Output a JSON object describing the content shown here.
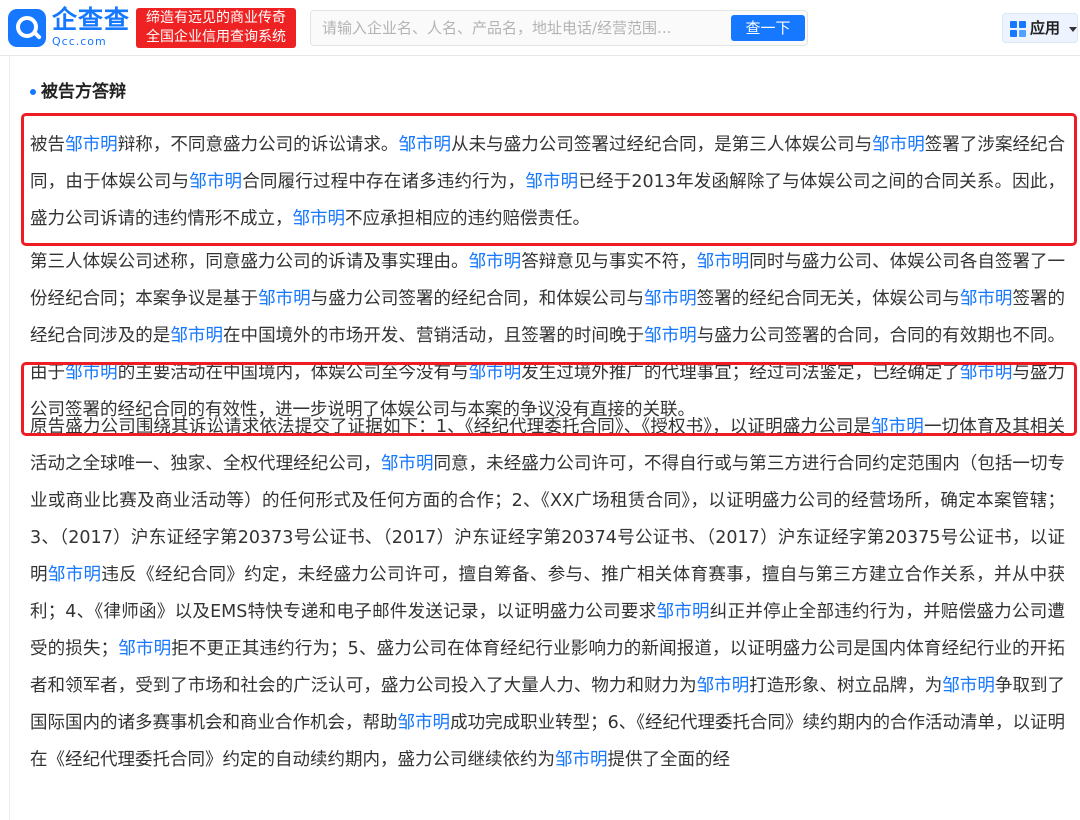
{
  "header": {
    "logo_cn": "企查查",
    "logo_en": "Qcc.com",
    "slogan_line1": "缔造有远见的商业传奇",
    "slogan_line2": "全国企业信用查询系统",
    "search_placeholder": "请输入企业名、人名、产品名，地址电话/经营范围...",
    "search_button": "查一下",
    "apps_label": "应用"
  },
  "colors": {
    "brand": "#1677ff",
    "highlight_border": "#ee1c24",
    "slogan_bg": "#ee2222",
    "link": "#1677ff"
  },
  "icons": [
    "qcc-logo-icon",
    "apps-grid-icon",
    "chevron-down-icon"
  ],
  "section": {
    "title": "被告方答辩"
  },
  "article": {
    "p1": [
      {
        "t": "被告"
      },
      {
        "t": "邹市明",
        "link": true
      },
      {
        "t": "辩称，不同意盛力公司的诉讼请求。"
      },
      {
        "t": "邹市明",
        "link": true
      },
      {
        "t": "从未与盛力公司签署过经纪合同，是第三人体娱公司与"
      },
      {
        "t": "邹市明",
        "link": true
      },
      {
        "t": "签署了涉案经纪合同，由于体娱公司与"
      },
      {
        "t": "邹市明",
        "link": true
      },
      {
        "t": "合同履行过程中存在诸多违约行为，"
      },
      {
        "t": "邹市明",
        "link": true
      },
      {
        "t": "已经于2013年发函解除了与体娱公司之间的合同关系。因此，盛力公司诉请的违约情形不成立，"
      },
      {
        "t": "邹市明",
        "link": true
      },
      {
        "t": "不应承担相应的违约赔偿责任。"
      }
    ],
    "p2": [
      {
        "t": "第三人体娱公司述称，同意盛力公司的诉请及事实理由。"
      },
      {
        "t": "邹市明",
        "link": true
      },
      {
        "t": "答辩意见与事实不符，"
      },
      {
        "t": "邹市明",
        "link": true
      },
      {
        "t": "同时与盛力公司、体娱公司各自签署了一份经纪合同；本案争议是基于"
      },
      {
        "t": "邹市明",
        "link": true
      },
      {
        "t": "与盛力公司签署的经纪合同，和体娱公司与"
      },
      {
        "t": "邹市明",
        "link": true
      },
      {
        "t": "签署的经纪合同无关，体娱公司与"
      },
      {
        "t": "邹市明",
        "link": true
      },
      {
        "t": "签署的经纪合同涉及的是"
      },
      {
        "t": "邹市明",
        "link": true
      },
      {
        "t": "在中国境外的市场开发、营销活动，且签署的时间晚于"
      },
      {
        "t": "邹市明",
        "link": true
      },
      {
        "t": "与盛力公司签署的合同，合同的有效期也不同。由于"
      },
      {
        "t": "邹市明",
        "link": true
      },
      {
        "t": "的主要活动在中国境内，体娱公司至今没有与"
      },
      {
        "t": "邹市明",
        "link": true
      },
      {
        "t": "发生过境外推广的代理事宜；经过司法鉴定，已经确定了"
      },
      {
        "t": "邹市明",
        "link": true
      },
      {
        "t": "与盛力公司签署的经纪合同的有效性，进一步说明了体娱公司与本案的争议没有直接的关联。"
      }
    ],
    "p3": [
      {
        "t": "原告盛力公司围绕其诉讼请求依法提交了证据如下：1、《经纪代理委托合同》、《授权书》，以证明盛力公司是"
      },
      {
        "t": "邹市明",
        "link": true
      },
      {
        "t": "一切体育及其相关活动之全球唯一、独家、全权代理经纪公司，"
      },
      {
        "t": "邹市明",
        "link": true
      },
      {
        "t": "同意，未经盛力公司许可，不得自行或与第三方进行合同约定范围内（包括一切专业或商业比赛及商业活动等）的任何形式及任何方面的合作；2、《XX广场租赁合同》，以证明盛力公司的经营场所，确定本案管辖；3、（2017）沪东证经字第20373号公证书、（2017）沪东证经字第20374号公证书、（2017）沪东证经字第20375号公证书，以证明"
      },
      {
        "t": "邹市明",
        "link": true
      },
      {
        "t": "违反《经纪合同》约定，未经盛力公司许可，擅自筹备、参与、推广相关体育赛事，擅自与第三方建立合作关系，并从中获利；4、《律师函》以及EMS特快专递和电子邮件发送记录，以证明盛力公司要求"
      },
      {
        "t": "邹市明",
        "link": true
      },
      {
        "t": "纠正并停止全部违约行为，并赔偿盛力公司遭受的损失；"
      },
      {
        "t": "邹市明",
        "link": true
      },
      {
        "t": "拒不更正其违约行为；5、盛力公司在体育经纪行业影响力的新闻报道，以证明盛力公司是国内体育经纪行业的开拓者和领军者，受到了市场和社会的广泛认可，盛力公司投入了大量人力、物力和财力为"
      },
      {
        "t": "邹市明",
        "link": true
      },
      {
        "t": "打造形象、树立品牌，为"
      },
      {
        "t": "邹市明",
        "link": true
      },
      {
        "t": "争取到了国际国内的诸多赛事机会和商业合作机会，帮助"
      },
      {
        "t": "邹市明",
        "link": true
      },
      {
        "t": "成功完成职业转型；6、《经纪代理委托合同》续约期内的合作活动清单，以证明在《经纪代理委托合同》约定的自动续约期内，盛力公司继续依约为"
      },
      {
        "t": "邹市明",
        "link": true
      },
      {
        "t": "提供了全面的经"
      }
    ]
  }
}
